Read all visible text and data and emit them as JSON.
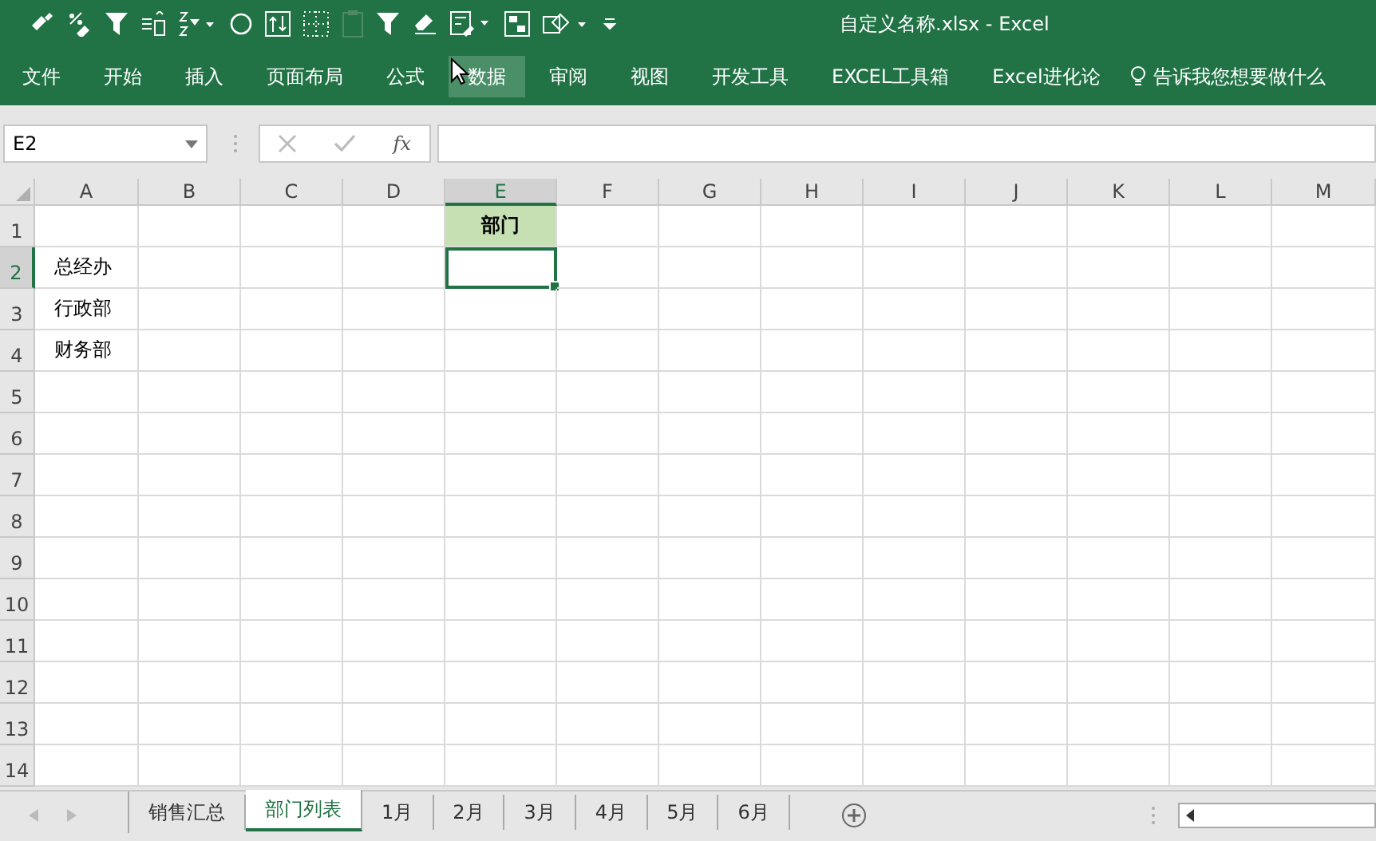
{
  "window": {
    "title": "自定义名称.xlsx - Excel"
  },
  "ribbon_tabs": [
    {
      "label": "文件",
      "selected": false
    },
    {
      "label": "开始",
      "selected": false
    },
    {
      "label": "插入",
      "selected": false
    },
    {
      "label": "页面布局",
      "selected": false
    },
    {
      "label": "公式",
      "selected": false
    },
    {
      "label": "数据",
      "selected": true
    },
    {
      "label": "审阅",
      "selected": false
    },
    {
      "label": "视图",
      "selected": false
    },
    {
      "label": "开发工具",
      "selected": false
    },
    {
      "label": "EXCEL工具箱",
      "selected": false
    },
    {
      "label": "Excel进化论",
      "selected": false
    }
  ],
  "tell_me": {
    "placeholder": "告诉我您想要做什么"
  },
  "name_box": {
    "value": "E2"
  },
  "formula_bar": {
    "fx": "fx"
  },
  "columns": [
    {
      "label": "A",
      "selected": false
    },
    {
      "label": "B",
      "selected": false
    },
    {
      "label": "C",
      "selected": false
    },
    {
      "label": "D",
      "selected": false
    },
    {
      "label": "E",
      "selected": true
    },
    {
      "label": "F",
      "selected": false
    },
    {
      "label": "G",
      "selected": false
    },
    {
      "label": "H",
      "selected": false
    },
    {
      "label": "I",
      "selected": false
    },
    {
      "label": "J",
      "selected": false
    },
    {
      "label": "K",
      "selected": false
    },
    {
      "label": "L",
      "selected": false
    },
    {
      "label": "M",
      "selected": false
    }
  ],
  "rows": [
    {
      "label": "1",
      "selected": false,
      "cells": [
        {
          "selected": false
        },
        {
          "selected": false
        },
        {
          "selected": false
        },
        {
          "selected": false
        },
        {
          "text": "部门",
          "kind": "header",
          "selected": false
        }
      ]
    },
    {
      "label": "2",
      "selected": true,
      "cells": [
        {
          "text": "总经办",
          "kind": "plain",
          "selected": false
        },
        {
          "selected": false
        },
        {
          "selected": false
        },
        {
          "selected": false
        },
        {
          "selected": true
        }
      ]
    },
    {
      "label": "3",
      "selected": false,
      "cells": [
        {
          "text": "行政部",
          "kind": "plain",
          "selected": false
        }
      ]
    },
    {
      "label": "4",
      "selected": false,
      "cells": [
        {
          "text": "财务部",
          "kind": "plain",
          "selected": false
        }
      ]
    },
    {
      "label": "5",
      "selected": false
    },
    {
      "label": "6",
      "selected": false
    },
    {
      "label": "7",
      "selected": false
    },
    {
      "label": "8",
      "selected": false
    },
    {
      "label": "9",
      "selected": false
    },
    {
      "label": "10",
      "selected": false
    },
    {
      "label": "11",
      "selected": false
    },
    {
      "label": "12",
      "selected": false
    },
    {
      "label": "13",
      "selected": false
    },
    {
      "label": "14",
      "selected": false
    }
  ],
  "sheet_tabs": [
    {
      "label": "销售汇总",
      "selected": false
    },
    {
      "label": "部门列表",
      "selected": true
    },
    {
      "label": "1月",
      "selected": false
    },
    {
      "label": "2月",
      "selected": false
    },
    {
      "label": "3月",
      "selected": false
    },
    {
      "label": "4月",
      "selected": false
    },
    {
      "label": "5月",
      "selected": false
    },
    {
      "label": "6月",
      "selected": false
    }
  ]
}
